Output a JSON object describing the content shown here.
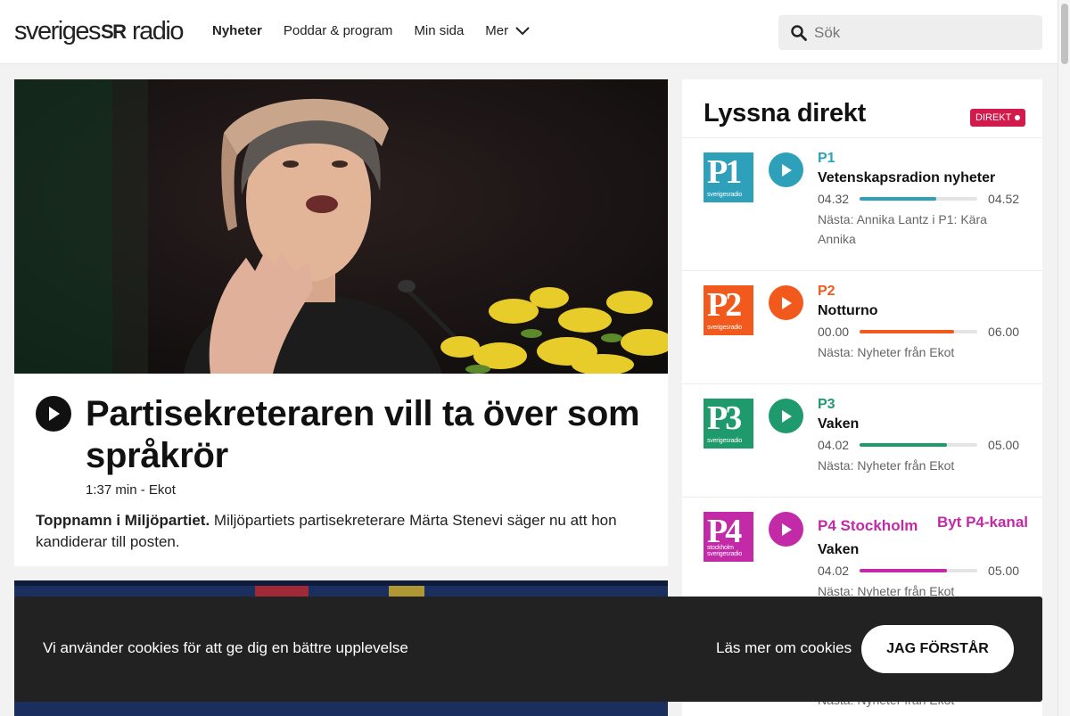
{
  "header": {
    "logo_left": "sveriges",
    "logo_mid": "SR",
    "logo_right": "radio",
    "nav": [
      {
        "label": "Nyheter"
      },
      {
        "label": "Poddar & program"
      },
      {
        "label": "Min sida"
      },
      {
        "label": "Mer"
      }
    ],
    "search_placeholder": "Sök"
  },
  "article": {
    "headline": "Partisekreteraren vill ta över som språkrör",
    "meta": "1:37 min - Ekot",
    "lead_bold": "Toppnamn i Miljöpartiet.",
    "lead_text": " Miljöpartiets partisekreterare Märta Stenevi säger nu att hon kandiderar till posten."
  },
  "live": {
    "title": "Lyssna direkt",
    "badge": "DIREKT",
    "channels": [
      {
        "logo": "P1",
        "logo_sub": "sverigesradio",
        "name": "P1",
        "program": "Vetenskapsradion nyheter",
        "start": "04.32",
        "end": "04.52",
        "progress": 0.65,
        "next": "Nästa: Annika Lantz i P1: Kära Annika",
        "color": "#2ea0ba"
      },
      {
        "logo": "P2",
        "logo_sub": "sverigesradio",
        "name": "P2",
        "program": "Notturno",
        "start": "00.00",
        "end": "06.00",
        "progress": 0.8,
        "next": "Nästa: Nyheter från Ekot",
        "color": "#f25a1d"
      },
      {
        "logo": "P3",
        "logo_sub": "sverigesradio",
        "name": "P3",
        "program": "Vaken",
        "start": "04.02",
        "end": "05.00",
        "progress": 0.74,
        "next": "Nästa: Nyheter från Ekot",
        "color": "#1f9a6c"
      },
      {
        "logo": "P4",
        "logo_sub": "stockholm sverigesradio",
        "name": "P4 Stockholm",
        "program": "Vaken",
        "start": "04.02",
        "end": "05.00",
        "progress": 0.74,
        "next": "Nästa: Nyheter från Ekot",
        "color": "#c22aa7",
        "switch": "Byt P4-kanal"
      }
    ],
    "extra_next": "Nästa: Nyheter från Ekot"
  },
  "cookie": {
    "text": "Vi använder cookies för att ge dig en bättre upplevelse",
    "more": "Läs mer om cookies",
    "accept": "JAG FÖRSTÅR"
  }
}
